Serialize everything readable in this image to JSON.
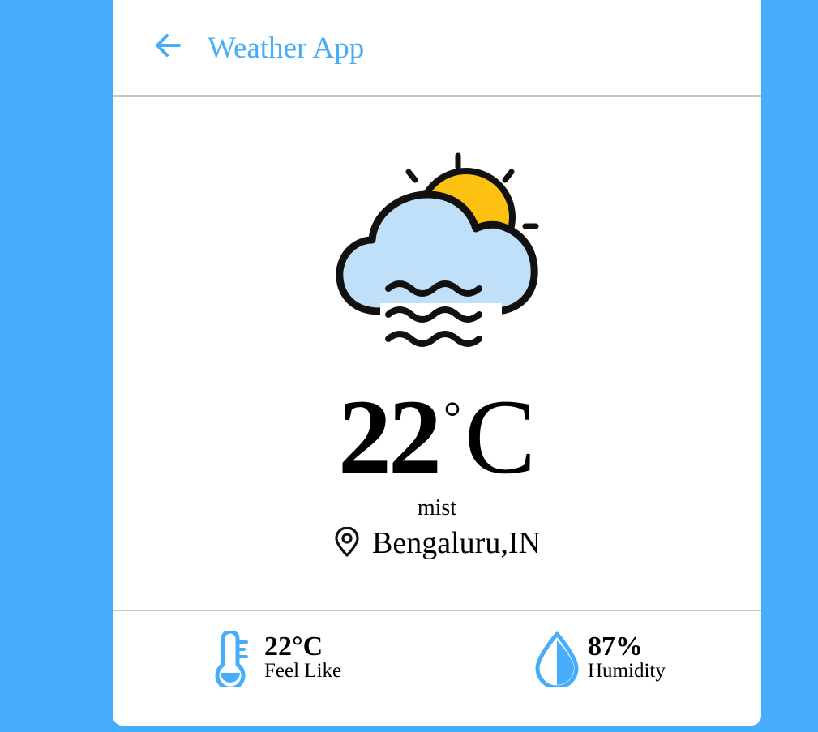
{
  "header": {
    "title": "Weather App",
    "back_icon": "arrow-left-icon",
    "accent_color": "#46adfb"
  },
  "weather": {
    "icon": "cloud-sun-mist-icon",
    "temperature": "22",
    "degree_symbol": "°",
    "unit": "C",
    "description": "mist",
    "location_icon": "map-pin-icon",
    "location": "Bengaluru,IN"
  },
  "stats": {
    "feels_like": {
      "icon": "thermometer-icon",
      "value": "22°C",
      "label": "Feel Like"
    },
    "humidity": {
      "icon": "water-drop-icon",
      "value": "87%",
      "label": "Humidity"
    }
  },
  "colors": {
    "background": "#46adfb",
    "card": "#ffffff",
    "cloud_fill": "#bfe0f8",
    "sun_fill": "#fdc211",
    "divider": "#c6c6c6"
  }
}
